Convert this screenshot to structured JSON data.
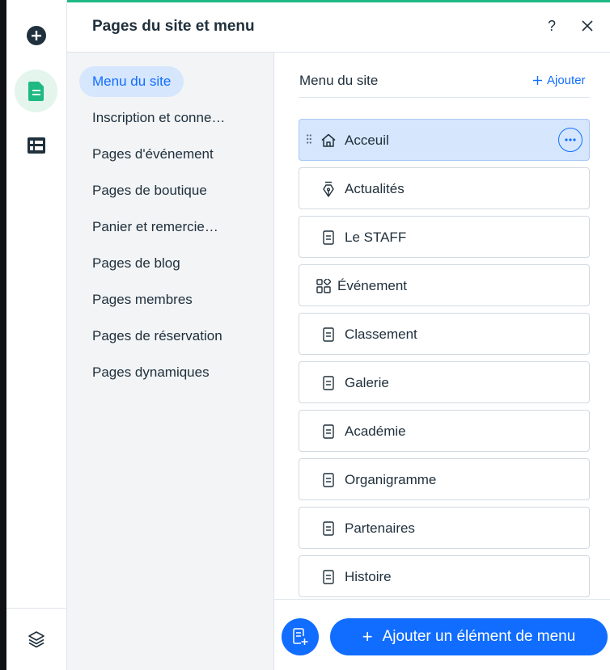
{
  "colors": {
    "accent": "#116dff",
    "accent_light": "#d5e6fd",
    "green_brand": "#1fb985",
    "rail_active_bg": "#e3f5ec",
    "text": "#20303c"
  },
  "rail": {
    "items": [
      {
        "icon": "add-circle-icon"
      },
      {
        "icon": "pages-icon",
        "active": true
      },
      {
        "icon": "table-icon"
      }
    ],
    "bottom_icon": "layers-icon"
  },
  "header": {
    "title": "Pages du site et menu",
    "help_label": "?",
    "close_icon": "close-icon"
  },
  "categories": [
    {
      "label": "Menu du site",
      "active": true
    },
    {
      "label": "Inscription et conne…"
    },
    {
      "label": "Pages d'événement"
    },
    {
      "label": "Pages de boutique"
    },
    {
      "label": "Panier et remercie…"
    },
    {
      "label": "Pages de blog"
    },
    {
      "label": "Pages membres"
    },
    {
      "label": "Pages de réservation"
    },
    {
      "label": "Pages dynamiques"
    }
  ],
  "menu": {
    "title": "Menu du site",
    "add_link": "Ajouter",
    "items": [
      {
        "label": "Acceuil",
        "icon": "home-icon",
        "selected": true
      },
      {
        "label": "Actualités",
        "icon": "pen-nib-icon"
      },
      {
        "label": "Le STAFF",
        "icon": "page-icon"
      },
      {
        "label": "Événement",
        "icon": "grid-apps-icon"
      },
      {
        "label": "Classement",
        "icon": "page-icon"
      },
      {
        "label": "Galerie",
        "icon": "page-icon"
      },
      {
        "label": "Académie",
        "icon": "page-icon"
      },
      {
        "label": "Organigramme",
        "icon": "page-icon"
      },
      {
        "label": "Partenaires",
        "icon": "page-icon"
      },
      {
        "label": "Histoire",
        "icon": "page-icon"
      }
    ]
  },
  "footer": {
    "page_button_icon": "add-page-icon",
    "add_button_label": "Ajouter un élément de menu"
  }
}
